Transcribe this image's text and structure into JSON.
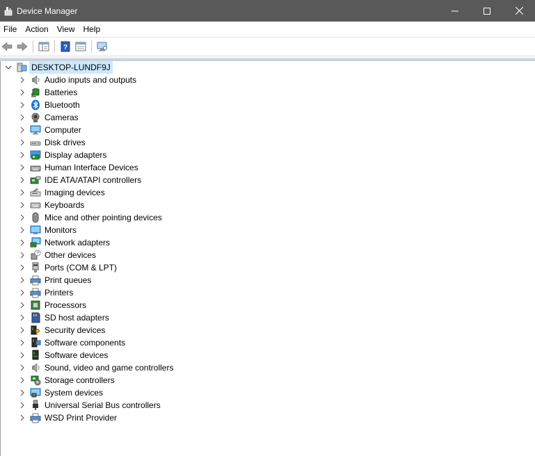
{
  "window": {
    "title": "Device Manager",
    "controls": [
      "minimize",
      "maximize",
      "close"
    ]
  },
  "menu": [
    {
      "label": "File"
    },
    {
      "label": "Action"
    },
    {
      "label": "View"
    },
    {
      "label": "Help"
    }
  ],
  "toolbar": [
    "back-icon",
    "forward-icon",
    "show-hide-console-tree-icon",
    "help-icon",
    "properties-icon",
    "scan-hardware-icon"
  ],
  "tree": {
    "root": {
      "label": "DESKTOP-LUNDF9J",
      "icon": "computer-icon",
      "expanded": true
    },
    "nodes": [
      {
        "label": "Audio inputs and outputs",
        "icon": "speaker-icon"
      },
      {
        "label": "Batteries",
        "icon": "battery-icon"
      },
      {
        "label": "Bluetooth",
        "icon": "bluetooth-icon"
      },
      {
        "label": "Cameras",
        "icon": "camera-icon"
      },
      {
        "label": "Computer",
        "icon": "computer-icon"
      },
      {
        "label": "Disk drives",
        "icon": "disk-drive-icon"
      },
      {
        "label": "Display adapters",
        "icon": "display-adapter-icon"
      },
      {
        "label": "Human Interface Devices",
        "icon": "hid-icon"
      },
      {
        "label": "IDE ATA/ATAPI controllers",
        "icon": "ide-controller-icon"
      },
      {
        "label": "Imaging devices",
        "icon": "imaging-device-icon"
      },
      {
        "label": "Keyboards",
        "icon": "keyboard-icon"
      },
      {
        "label": "Mice and other pointing devices",
        "icon": "mouse-icon"
      },
      {
        "label": "Monitors",
        "icon": "monitor-icon"
      },
      {
        "label": "Network adapters",
        "icon": "network-adapter-icon"
      },
      {
        "label": "Other devices",
        "icon": "other-device-icon"
      },
      {
        "label": "Ports (COM & LPT)",
        "icon": "port-icon"
      },
      {
        "label": "Print queues",
        "icon": "print-queue-icon"
      },
      {
        "label": "Printers",
        "icon": "printer-icon"
      },
      {
        "label": "Processors",
        "icon": "processor-icon"
      },
      {
        "label": "SD host adapters",
        "icon": "sd-adapter-icon"
      },
      {
        "label": "Security devices",
        "icon": "security-device-icon"
      },
      {
        "label": "Software components",
        "icon": "software-component-icon"
      },
      {
        "label": "Software devices",
        "icon": "software-device-icon"
      },
      {
        "label": "Sound, video and game controllers",
        "icon": "sound-controller-icon"
      },
      {
        "label": "Storage controllers",
        "icon": "storage-controller-icon"
      },
      {
        "label": "System devices",
        "icon": "system-device-icon"
      },
      {
        "label": "Universal Serial Bus controllers",
        "icon": "usb-icon"
      },
      {
        "label": "WSD Print Provider",
        "icon": "wsd-print-icon"
      }
    ]
  },
  "colors": {
    "titlebar": "#595959",
    "selection": "#cce8ff",
    "accent_blue": "#1e73d2"
  }
}
